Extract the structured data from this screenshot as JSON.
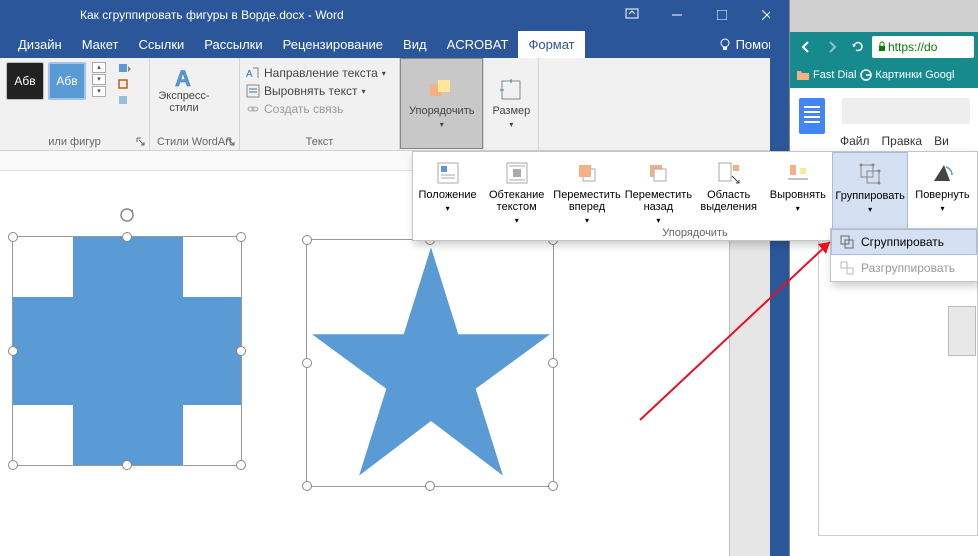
{
  "title_bar": {
    "title": "Как сгруппировать фигуры в Ворде.docx - Word"
  },
  "menu_tabs": {
    "design": "Дизайн",
    "layout": "Макет",
    "references": "Ссылки",
    "mailings": "Рассылки",
    "review": "Рецензирование",
    "view": "Вид",
    "acrobat": "ACROBAT",
    "format": "Формат",
    "help": "Помощ"
  },
  "ribbon": {
    "abc": "Абв",
    "shape_styles_label": "или фигур",
    "wordart": {
      "button": "Экспресс-\nстили",
      "label": "Стили WordArt"
    },
    "text": {
      "direction": "Направление текста",
      "align": "Выровнять текст",
      "link": "Создать связь",
      "label": "Текст"
    },
    "arrange_btn": "Упорядочить",
    "size_btn": "Размер"
  },
  "arrange_popup": {
    "position": "Положение",
    "wrap": "Обтекание\nтекстом",
    "forward": "Переместить\nвперед",
    "backward": "Переместить\nназад",
    "selection": "Область\nвыделения",
    "align": "Выровнять",
    "group": "Группировать",
    "rotate": "Повернуть",
    "label": "Упорядочить"
  },
  "group_submenu": {
    "group": "Сгруппировать",
    "ungroup": "Разгруппировать"
  },
  "chrome": {
    "url_prefix": "https://do",
    "bm_fastdial": "Fast Dial",
    "bm_google": "Картинки Googl"
  },
  "docs": {
    "menu_file": "Файл",
    "menu_edit": "Правка",
    "menu_view": "Ви"
  }
}
